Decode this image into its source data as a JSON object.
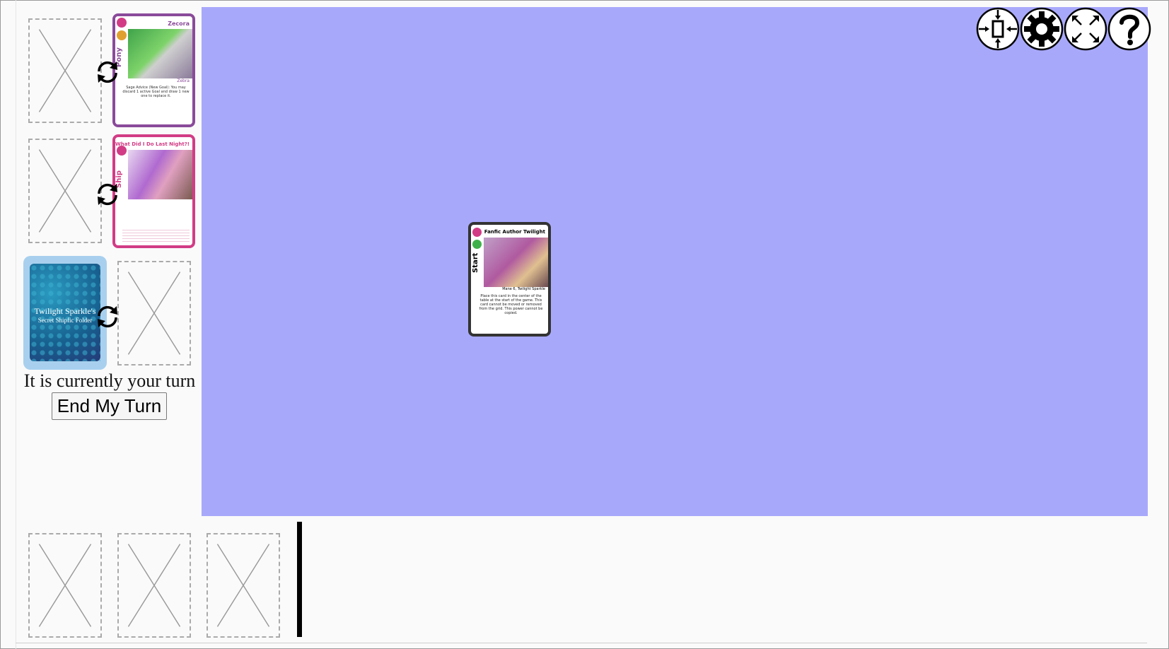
{
  "status": {
    "turn_text": "It is currently your turn",
    "end_turn_label": "End My Turn"
  },
  "colors": {
    "board": "#a8a8fb",
    "pony_card": "#8a4a9a",
    "ship_card": "#d23c86",
    "deck_back": "#1f78a4",
    "start_card": "#333333"
  },
  "toolbar": {
    "icons": [
      "center-board-icon",
      "gear-icon",
      "fullscreen-icon",
      "help-icon"
    ]
  },
  "goal_row_1": {
    "card": {
      "type_label": "Pony",
      "name": "Zecora",
      "subtitle": "Zebra",
      "power": "Sage Advice (New Goal): You may discard 1 active Goal and draw 1 new one to replace it."
    }
  },
  "goal_row_2": {
    "card": {
      "type_label": "Ship",
      "name": "What Did I Do Last Night?!"
    }
  },
  "deck": {
    "title": "Twilight Sparkle's",
    "subtitle": "Secret Shipfic Folder"
  },
  "board_card": {
    "type_label": "Start",
    "name": "Fanfic Author Twilight",
    "subtitle": "Mane 6, Twilight Sparkle",
    "rules": "Place this card in the center of the table at the start of the game. This card cannot be moved or removed from the grid. This power cannot be copied."
  }
}
